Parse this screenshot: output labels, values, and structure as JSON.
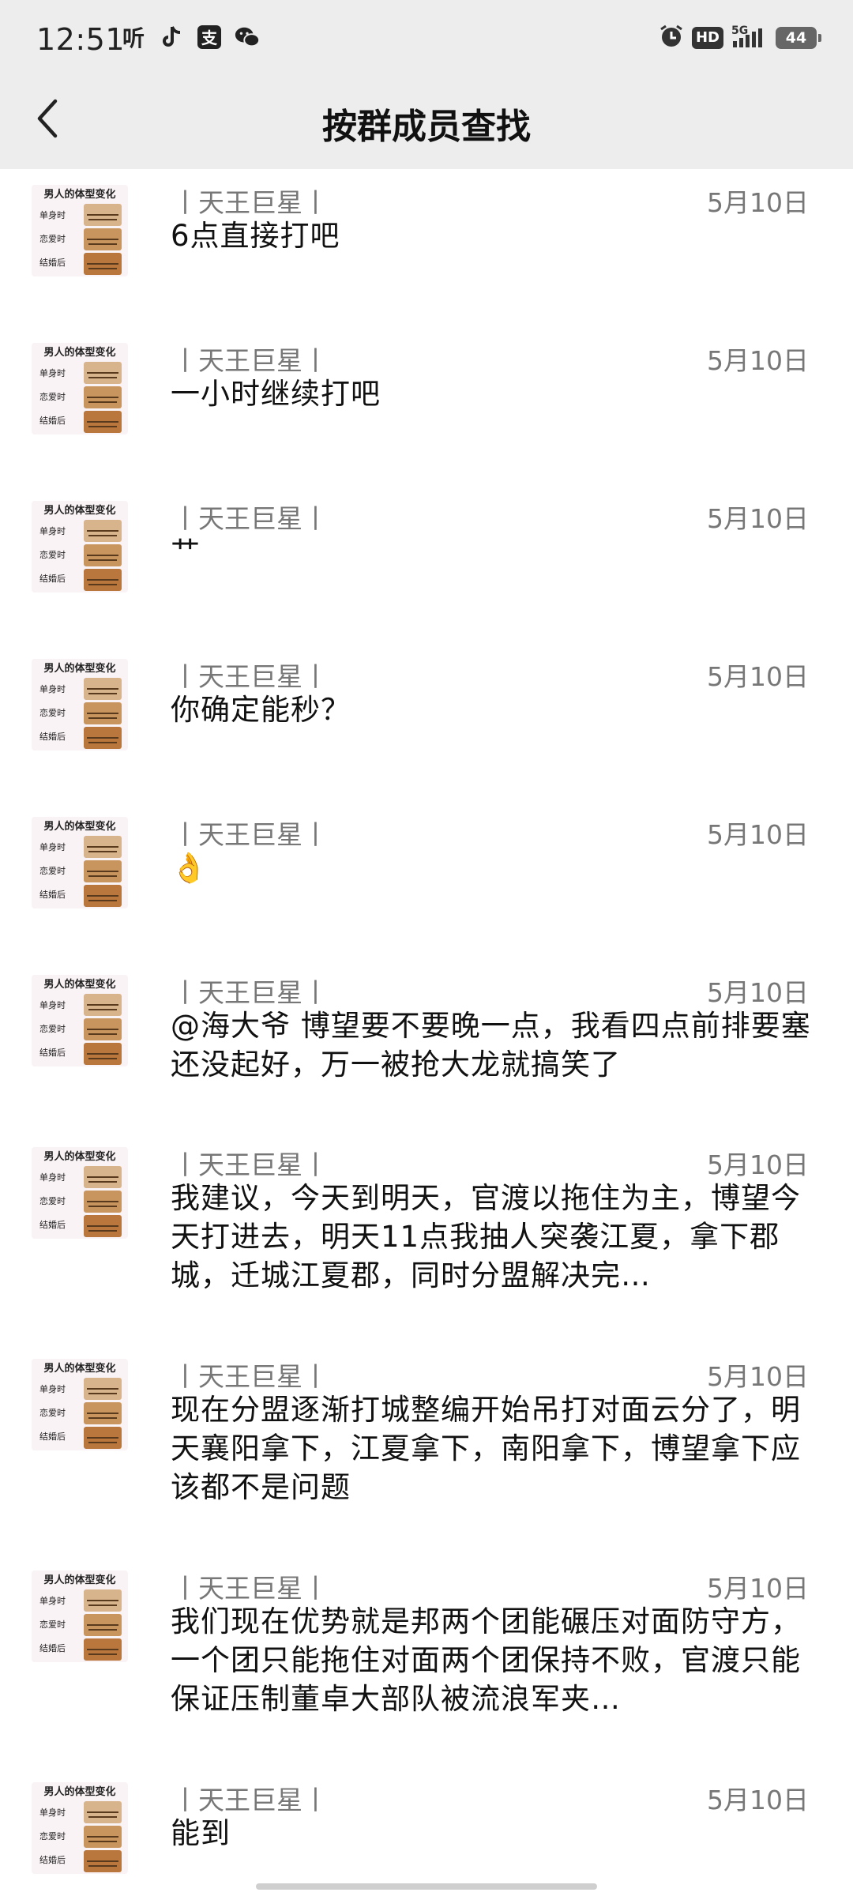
{
  "status_bar": {
    "time": "12:51",
    "left_icons": [
      "听",
      "tiktok-icon",
      "支",
      "wechat-icon"
    ],
    "hd": "HD",
    "network": "5G",
    "battery": "44"
  },
  "header": {
    "title": "按群成员查找"
  },
  "avatar": {
    "title": "男人的体型变化",
    "labels": [
      "单身时",
      "恋爱时",
      "结婚后"
    ]
  },
  "messages": [
    {
      "sender": "丨天王巨星丨",
      "date": "5月10日",
      "text": "6点直接打吧"
    },
    {
      "sender": "丨天王巨星丨",
      "date": "5月10日",
      "text": "一小时继续打吧"
    },
    {
      "sender": "丨天王巨星丨",
      "date": "5月10日",
      "text": "艹"
    },
    {
      "sender": "丨天王巨星丨",
      "date": "5月10日",
      "text": "你确定能秒？"
    },
    {
      "sender": "丨天王巨星丨",
      "date": "5月10日",
      "text": "👌"
    },
    {
      "sender": "丨天王巨星丨",
      "date": "5月10日",
      "text": "@海大爷 博望要不要晚一点，我看四点前排要塞还没起好，万一被抢大龙就搞笑了"
    },
    {
      "sender": "丨天王巨星丨",
      "date": "5月10日",
      "text": "我建议，今天到明天，官渡以拖住为主，博望今天打进去，明天11点我抽人突袭江夏，拿下郡城，迁城江夏郡，同时分盟解决完…"
    },
    {
      "sender": "丨天王巨星丨",
      "date": "5月10日",
      "text": "现在分盟逐渐打城整编开始吊打对面云分了，明天襄阳拿下，江夏拿下，南阳拿下，博望拿下应该都不是问题"
    },
    {
      "sender": "丨天王巨星丨",
      "date": "5月10日",
      "text": "我们现在优势就是邦两个团能碾压对面防守方，一个团只能拖住对面两个团保持不败，官渡只能保证压制董卓大部队被流浪军夹…"
    },
    {
      "sender": "丨天王巨星丨",
      "date": "5月10日",
      "text": "能到"
    }
  ]
}
